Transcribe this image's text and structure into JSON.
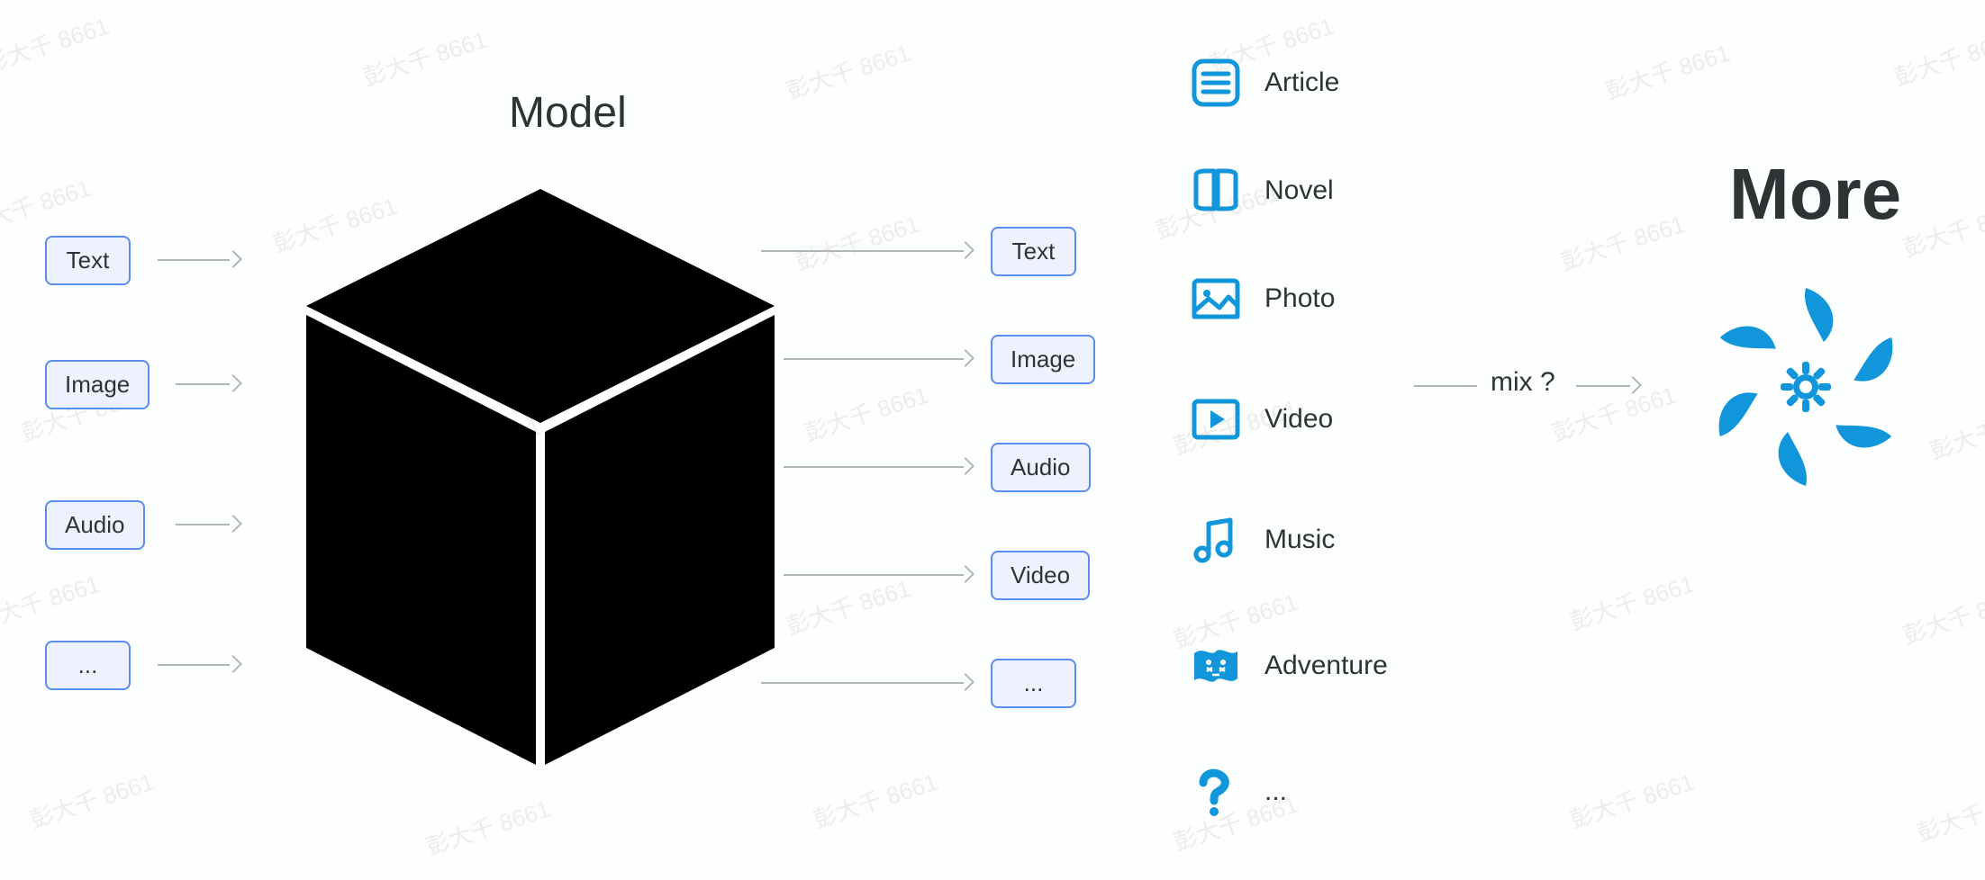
{
  "watermark_text": "彭大千 8661",
  "model_title": "Model",
  "inputs": [
    "Text",
    "Image",
    "Audio",
    "..."
  ],
  "modalities": [
    "Text",
    "Image",
    "Audio",
    "Video",
    "..."
  ],
  "outputs": [
    {
      "icon": "article-icon",
      "label": "Article"
    },
    {
      "icon": "novel-icon",
      "label": "Novel"
    },
    {
      "icon": "photo-icon",
      "label": "Photo"
    },
    {
      "icon": "video-icon",
      "label": "Video"
    },
    {
      "icon": "music-icon",
      "label": "Music"
    },
    {
      "icon": "adventure-icon",
      "label": "Adventure"
    },
    {
      "icon": "question-icon",
      "label": "..."
    }
  ],
  "mix_label": "mix ?",
  "more_label": "More",
  "colors": {
    "accent": "#1296db",
    "tag_border": "#5b8def",
    "tag_bg": "#eef2ff",
    "text": "#2d3436",
    "arrow": "#b0b6bb"
  }
}
